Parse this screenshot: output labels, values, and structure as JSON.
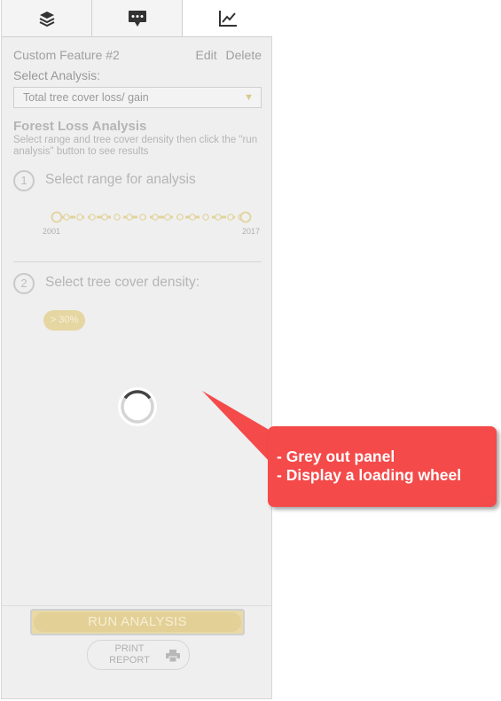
{
  "tabs": [
    {
      "icon": "layers-icon"
    },
    {
      "icon": "comment-icon"
    },
    {
      "icon": "chart-line-icon"
    }
  ],
  "feature": {
    "title": "Custom Feature #2",
    "edit_label": "Edit",
    "delete_label": "Delete"
  },
  "select_analysis": {
    "label": "Select Analysis:",
    "value": "Total tree cover loss/ gain"
  },
  "forest_loss": {
    "heading": "Forest Loss Analysis",
    "description": "Select range and tree cover density then click the \"run analysis\" button to see results"
  },
  "steps": [
    {
      "number": "1",
      "text": "Select range for analysis"
    },
    {
      "number": "2",
      "text": "Select tree cover density:"
    }
  ],
  "range": {
    "start_label": "2001",
    "end_label": "2017"
  },
  "density_badge": "> 30%",
  "buttons": {
    "run_analysis": "RUN ANALYSIS",
    "print_report": "PRINT REPORT"
  },
  "callout": {
    "line1": "- Grey out panel",
    "line2": "- Display a loading wheel"
  },
  "colors": {
    "callout": "#f44a4a",
    "accent_gold": "#e3d097",
    "panel_grey": "#efefef"
  }
}
